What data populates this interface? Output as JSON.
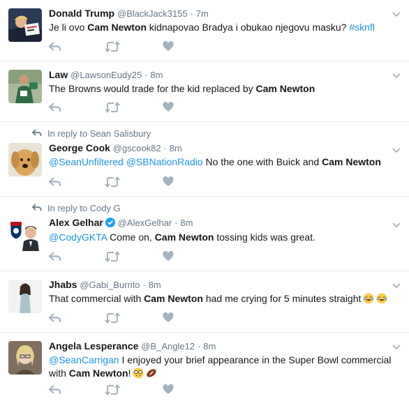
{
  "tweets": [
    {
      "name": "Donald Trump",
      "handle": "@BlackJack3155",
      "sep": "·",
      "time": "7m",
      "segments": [
        {
          "t": "Je li ovo ",
          "s": "n"
        },
        {
          "t": "Cam Newton",
          "s": "b"
        },
        {
          "t": " kidnapovao Bradya i obukao njegovu masku? ",
          "s": "n"
        },
        {
          "t": "#sknfl",
          "s": "l"
        }
      ]
    },
    {
      "name": "Law",
      "handle": "@LawsonEudy25",
      "sep": "·",
      "time": "8m",
      "segments": [
        {
          "t": "The Browns would trade for the kid replaced by ",
          "s": "n"
        },
        {
          "t": "Cam Newton",
          "s": "b"
        }
      ]
    },
    {
      "reply_to": "In reply to Sean Salisbury",
      "name": "George Cook",
      "handle": "@gscook82",
      "sep": "·",
      "time": "8m",
      "segments": [
        {
          "t": "@SeanUnfiltered",
          "s": "l"
        },
        {
          "t": " ",
          "s": "n"
        },
        {
          "t": "@SBNationRadio",
          "s": "l"
        },
        {
          "t": "  No the one with Buick and ",
          "s": "n"
        },
        {
          "t": "Cam Newton",
          "s": "b"
        }
      ]
    },
    {
      "reply_to": "In reply to Cody G",
      "name": "Alex Gelhar",
      "verified": true,
      "handle": "@AlexGelhar",
      "sep": "·",
      "time": "8m",
      "segments": [
        {
          "t": "@CodyGKTA",
          "s": "l"
        },
        {
          "t": " Come on, ",
          "s": "n"
        },
        {
          "t": "Cam Newton",
          "s": "b"
        },
        {
          "t": " tossing kids was great.",
          "s": "n"
        }
      ]
    },
    {
      "name": "Jhabs",
      "handle": "@Gabi_Burrito",
      "sep": "·",
      "time": "8m",
      "segments": [
        {
          "t": "That commercial with ",
          "s": "n"
        },
        {
          "t": "Cam Newton",
          "s": "b"
        },
        {
          "t": " had me crying for 5 minutes straight",
          "s": "n"
        }
      ],
      "emojis": [
        "crying-laughing-emoji",
        "crying-laughing-emoji"
      ]
    },
    {
      "name": "Angela Lesperance",
      "handle": "@B_Angle12",
      "sep": "·",
      "time": "8m",
      "segments": [
        {
          "t": "@SeanCarrigan",
          "s": "l"
        },
        {
          "t": " I enjoyed your brief appearance in the Super Bowl commercial with ",
          "s": "n"
        },
        {
          "t": "Cam Newton",
          "s": "b"
        },
        {
          "t": "!",
          "s": "n"
        }
      ],
      "emojis": [
        "nerd-face-emoji",
        "football-emoji"
      ]
    }
  ],
  "colors": {
    "link": "#1b95e0",
    "muted": "#657786",
    "icon": "#a5b3bf",
    "text": "#14171a",
    "divider": "#e6ecf0",
    "verified": "#1da1f2"
  }
}
